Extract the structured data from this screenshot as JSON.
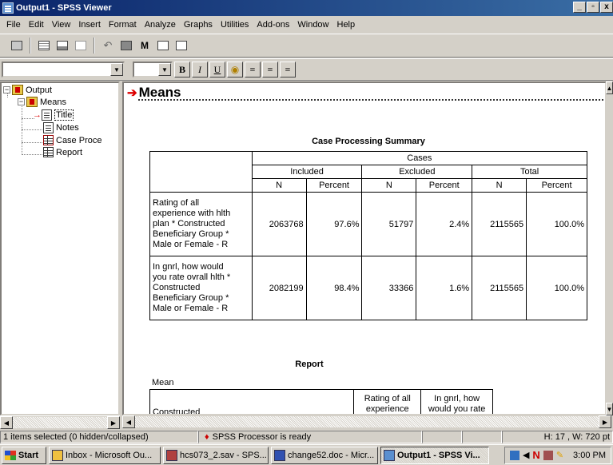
{
  "window": {
    "title": "Output1 - SPSS Viewer"
  },
  "menu": [
    "File",
    "Edit",
    "View",
    "Insert",
    "Format",
    "Analyze",
    "Graphs",
    "Utilities",
    "Add-ons",
    "Window",
    "Help"
  ],
  "format_toolbar": {
    "bold": "B",
    "italic": "I",
    "underline": "U"
  },
  "outline": {
    "root": "Output",
    "means": "Means",
    "title": "Title",
    "notes": "Notes",
    "case_proc": "Case Proce",
    "report": "Report"
  },
  "content": {
    "heading": "Means",
    "case_summary": {
      "caption": "Case Processing Summary",
      "cases": "Cases",
      "groups": [
        "Included",
        "Excluded",
        "Total"
      ],
      "subheads": [
        "N",
        "Percent",
        "N",
        "Percent",
        "N",
        "Percent"
      ],
      "rows": [
        {
          "label": [
            "Rating of all",
            "experience with hlth",
            "plan  * Constructed",
            "Beneficiary Group *",
            "Male or Female  - R"
          ],
          "values": [
            "2063768",
            "97.6%",
            "51797",
            "2.4%",
            "2115565",
            "100.0%"
          ]
        },
        {
          "label": [
            "In gnrl, how would",
            "you rate ovrall hlth  *",
            "Constructed",
            "Beneficiary Group *",
            "Male or Female  - R"
          ],
          "values": [
            "2082199",
            "98.4%",
            "33366",
            "1.6%",
            "2115565",
            "100.0%"
          ]
        }
      ]
    },
    "report": {
      "caption": "Report",
      "mean_label": "Mean",
      "col0": "Constructed",
      "col1": [
        "Rating of all",
        "experience"
      ],
      "col2": [
        "In gnrl, how",
        "would you rate"
      ]
    }
  },
  "status": {
    "selection": "1 items selected (0 hidden/collapsed)",
    "processor": "SPSS Processor  is ready",
    "dims": "H: 17 , W: 720  pt"
  },
  "taskbar": {
    "start": "Start",
    "tasks": [
      "Inbox - Microsoft Ou...",
      "hcs073_2.sav - SPS...",
      "change52.doc - Micr...",
      "Output1 - SPSS Vi..."
    ],
    "clock": "3:00 PM"
  }
}
